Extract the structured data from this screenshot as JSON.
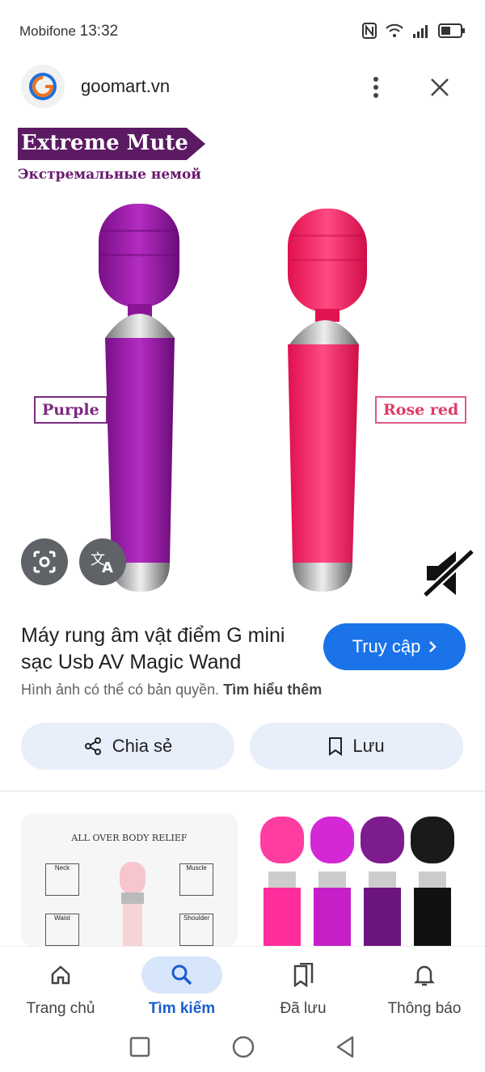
{
  "status_bar": {
    "carrier": "Mobifone",
    "time": "13:32",
    "icons": [
      "nfc-icon",
      "wifi-icon",
      "signal-icon",
      "battery-icon"
    ]
  },
  "browser_header": {
    "site": "goomart.vn",
    "icons": [
      "site-logo-icon",
      "more-vert-icon",
      "close-icon"
    ]
  },
  "hero_image": {
    "banner_title": "Extreme Mute",
    "subtitle": "Экстремальные немой",
    "left_label": "Purple",
    "right_label": "Rose red",
    "left_color": "#9a1fa8",
    "right_color": "#ff2b6e"
  },
  "result": {
    "title": "Máy rung âm vật điểm G mini sạc Usb AV Magic Wand",
    "visit_label": "Truy cập",
    "copyright_text": "Hình ảnh có thể có bản quyền.",
    "learn_more": "Tìm hiểu thêm",
    "share_label": "Chia sẻ",
    "save_label": "Lưu"
  },
  "related": {
    "card1_text": "ALL OVER BODY RELIEF",
    "card1_labels": [
      "Neck",
      "Muscle",
      "Waist",
      "Shoulder"
    ]
  },
  "bottom_nav": {
    "items": [
      {
        "label": "Trang chủ",
        "icon": "home-icon"
      },
      {
        "label": "Tìm kiếm",
        "icon": "search-icon",
        "active": true
      },
      {
        "label": "Đã lưu",
        "icon": "saved-icon"
      },
      {
        "label": "Thông báo",
        "icon": "bell-icon"
      }
    ]
  },
  "colors": {
    "accent": "#1a73e8",
    "pill_bg": "#e8effb"
  }
}
